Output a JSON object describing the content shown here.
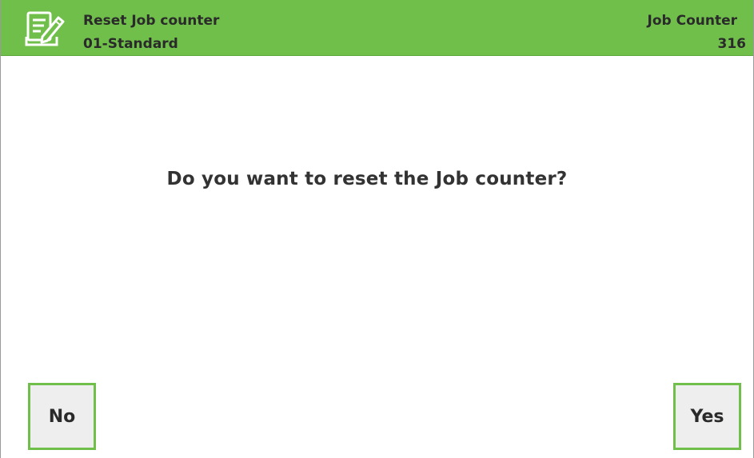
{
  "header": {
    "icon": "edit-document-icon",
    "title": "Reset Job counter",
    "subtitle": "01-Standard",
    "counter_label": "Job Counter",
    "counter_value": "316"
  },
  "dialog": {
    "question": "Do you want to reset the Job counter?"
  },
  "buttons": {
    "no_label": "No",
    "yes_label": "Yes"
  },
  "colors": {
    "accent": "#70bf4b",
    "button_bg": "#eeeeee",
    "text": "#2a2a2a"
  }
}
